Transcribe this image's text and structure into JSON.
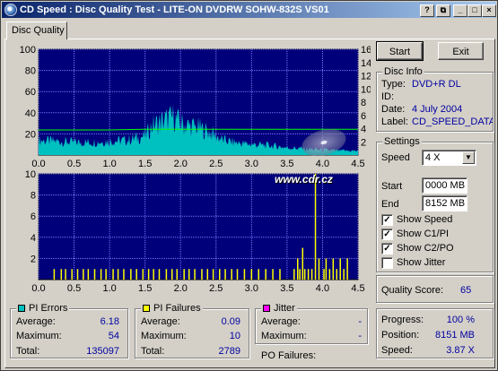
{
  "window": {
    "title": "CD Speed : Disc Quality Test - LITE-ON DVDRW SOHW-832S  VS01"
  },
  "tab": {
    "label": "Disc Quality"
  },
  "buttons": {
    "start": "Start",
    "exit": "Exit"
  },
  "disc_info": {
    "title": "Disc Info",
    "type_label": "Type:",
    "type_value": "DVD+R DL",
    "id_label": "ID:",
    "id_value": "",
    "date_label": "Date:",
    "date_value": "4 July 2004",
    "label_label": "Label:",
    "label_value": "CD_SPEED_DATA"
  },
  "settings": {
    "title": "Settings",
    "speed_label": "Speed",
    "speed_value": "4 X",
    "start_label": "Start",
    "start_value": "0000 MB",
    "end_label": "End",
    "end_value": "8152 MB",
    "show_speed": "Show Speed",
    "show_speed_checked": true,
    "show_c1": "Show C1/PI",
    "show_c1_checked": true,
    "show_c2": "Show C2/PO",
    "show_c2_checked": true,
    "show_jitter": "Show Jitter",
    "show_jitter_checked": false
  },
  "quality": {
    "label": "Quality Score:",
    "value": "65"
  },
  "progress": {
    "progress_label": "Progress:",
    "progress_value": "100 %",
    "position_label": "Position:",
    "position_value": "8151 MB",
    "speed_label": "Speed:",
    "speed_value": "3.87 X"
  },
  "pi_errors": {
    "title": "PI Errors",
    "color": "#00c0c0",
    "avg_label": "Average:",
    "avg": "6.18",
    "max_label": "Maximum:",
    "max": "54",
    "total_label": "Total:",
    "total": "135097"
  },
  "pi_failures": {
    "title": "PI Failures",
    "color": "#ffff00",
    "avg_label": "Average:",
    "avg": "0.09",
    "max_label": "Maximum:",
    "max": "10",
    "total_label": "Total:",
    "total": "2789"
  },
  "jitter": {
    "title": "Jitter",
    "color": "#ff00ff",
    "avg_label": "Average:",
    "avg": "-",
    "max_label": "Maximum:",
    "max": "-"
  },
  "po_failures": {
    "label": "PO Failures:",
    "value": ""
  },
  "watermark": {
    "text": "www.cdr.cz"
  },
  "colors": {
    "plot_bg": "#00007b",
    "grid": "#7b7bff",
    "pi_errors": "#00c0c0",
    "pi_failures": "#ffff00",
    "speed": "#00ff00"
  },
  "chart_data": [
    {
      "type": "area",
      "series": [
        {
          "name": "PI Errors",
          "x": [
            0.0,
            0.25,
            0.5,
            0.75,
            1.0,
            1.25,
            1.5,
            1.6,
            1.75,
            1.9,
            2.0,
            2.1,
            2.25,
            2.4,
            2.5,
            2.6,
            2.75,
            3.0,
            3.25,
            3.5,
            3.75,
            4.0,
            4.25,
            4.5
          ],
          "y": [
            14,
            13,
            12,
            12,
            13,
            14,
            18,
            28,
            32,
            36,
            30,
            28,
            26,
            22,
            18,
            14,
            12,
            10,
            9,
            7,
            6,
            5,
            4,
            4
          ]
        },
        {
          "name": "Speed",
          "x": [
            0.0,
            0.5,
            1.0,
            1.5,
            2.0,
            2.5,
            3.0,
            3.5,
            4.0,
            4.5
          ],
          "y": [
            3.8,
            3.8,
            3.8,
            3.9,
            3.9,
            3.9,
            3.9,
            3.9,
            3.9,
            3.9
          ]
        }
      ],
      "xlim": [
        0,
        4.5
      ],
      "ylim": [
        0,
        100
      ],
      "y2lim": [
        0,
        16
      ],
      "xticks": [
        "0.0",
        "0.5",
        "1.0",
        "1.5",
        "2.0",
        "2.5",
        "3.0",
        "3.5",
        "4.0",
        "4.5"
      ],
      "yticks": [
        "20",
        "40",
        "60",
        "80",
        "100"
      ],
      "y2ticks": [
        "2",
        "4",
        "6",
        "8",
        "10",
        "12",
        "14",
        "16"
      ]
    },
    {
      "type": "bar",
      "series": [
        {
          "name": "PI Failures",
          "x": [
            0.22,
            0.32,
            0.38,
            0.47,
            0.55,
            0.63,
            0.7,
            0.79,
            0.88,
            0.95,
            1.05,
            1.12,
            1.2,
            1.3,
            1.38,
            1.47,
            1.55,
            1.62,
            1.7,
            1.8,
            1.88,
            1.95,
            2.05,
            2.12,
            2.2,
            2.3,
            2.38,
            2.46,
            2.55,
            2.63,
            2.72,
            2.8,
            2.9,
            3.0,
            3.1,
            3.2,
            3.3,
            3.4,
            3.6,
            3.65,
            3.68,
            3.72,
            3.75,
            3.8,
            3.85,
            3.9,
            3.95,
            4.02,
            4.05,
            4.1,
            4.15,
            4.2,
            4.25,
            4.3,
            4.35
          ],
          "y": [
            1,
            1,
            1,
            1,
            1,
            1,
            1,
            1,
            1,
            1,
            1,
            1,
            1,
            1,
            1,
            1,
            1,
            1,
            1,
            1,
            1,
            1,
            1,
            1,
            1,
            1,
            1,
            1,
            1,
            1,
            1,
            1,
            1,
            1,
            1,
            1,
            1,
            1,
            1,
            2,
            1,
            3,
            1,
            1,
            1,
            10,
            2,
            1,
            2,
            1,
            2,
            1,
            2,
            1,
            2
          ]
        }
      ],
      "xlim": [
        0,
        4.5
      ],
      "ylim": [
        0,
        10
      ],
      "xticks": [
        "0.0",
        "0.5",
        "1.0",
        "1.5",
        "2.0",
        "2.5",
        "3.0",
        "3.5",
        "4.0",
        "4.5"
      ],
      "yticks": [
        "2",
        "4",
        "6",
        "8",
        "10"
      ]
    }
  ]
}
